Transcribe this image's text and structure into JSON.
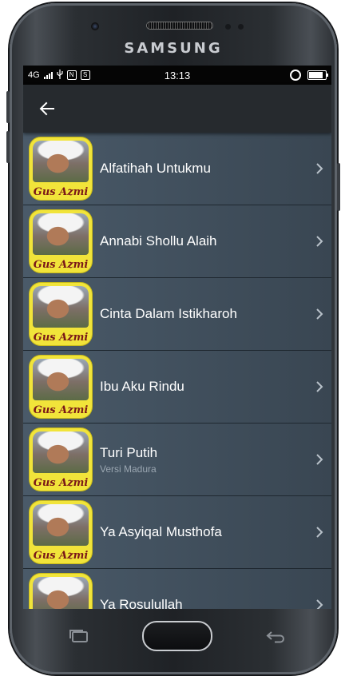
{
  "device": {
    "brand": "SAMSUNG"
  },
  "status_bar": {
    "network": "4G",
    "time": "13:13",
    "battery_level": 0.85,
    "icons": [
      "signal-icon",
      "usb-icon",
      "nfc-icon",
      "sd-icon",
      "alarm-icon",
      "battery-icon"
    ]
  },
  "app_bar": {
    "back_icon": "arrow-left-icon"
  },
  "thumbnail_caption": "Gus Azmi",
  "songs": [
    {
      "title": "Alfatihah Untukmu",
      "subtitle": ""
    },
    {
      "title": "Annabi Shollu Alaih",
      "subtitle": ""
    },
    {
      "title": "Cinta Dalam Istikharoh",
      "subtitle": ""
    },
    {
      "title": "Ibu Aku Rindu",
      "subtitle": ""
    },
    {
      "title": "Turi Putih",
      "subtitle": "Versi Madura"
    },
    {
      "title": "Ya Asyiqal Musthofa",
      "subtitle": ""
    },
    {
      "title": "Ya Rosulullah",
      "subtitle": ""
    }
  ],
  "colors": {
    "thumbnail_bg": "#f1e43a",
    "caption": "#7a1818",
    "appbar": "#262a2e",
    "list_bg": "#435260"
  },
  "nav_bar": {
    "icons": [
      "recent-apps-icon",
      "home-button",
      "back-icon"
    ]
  }
}
